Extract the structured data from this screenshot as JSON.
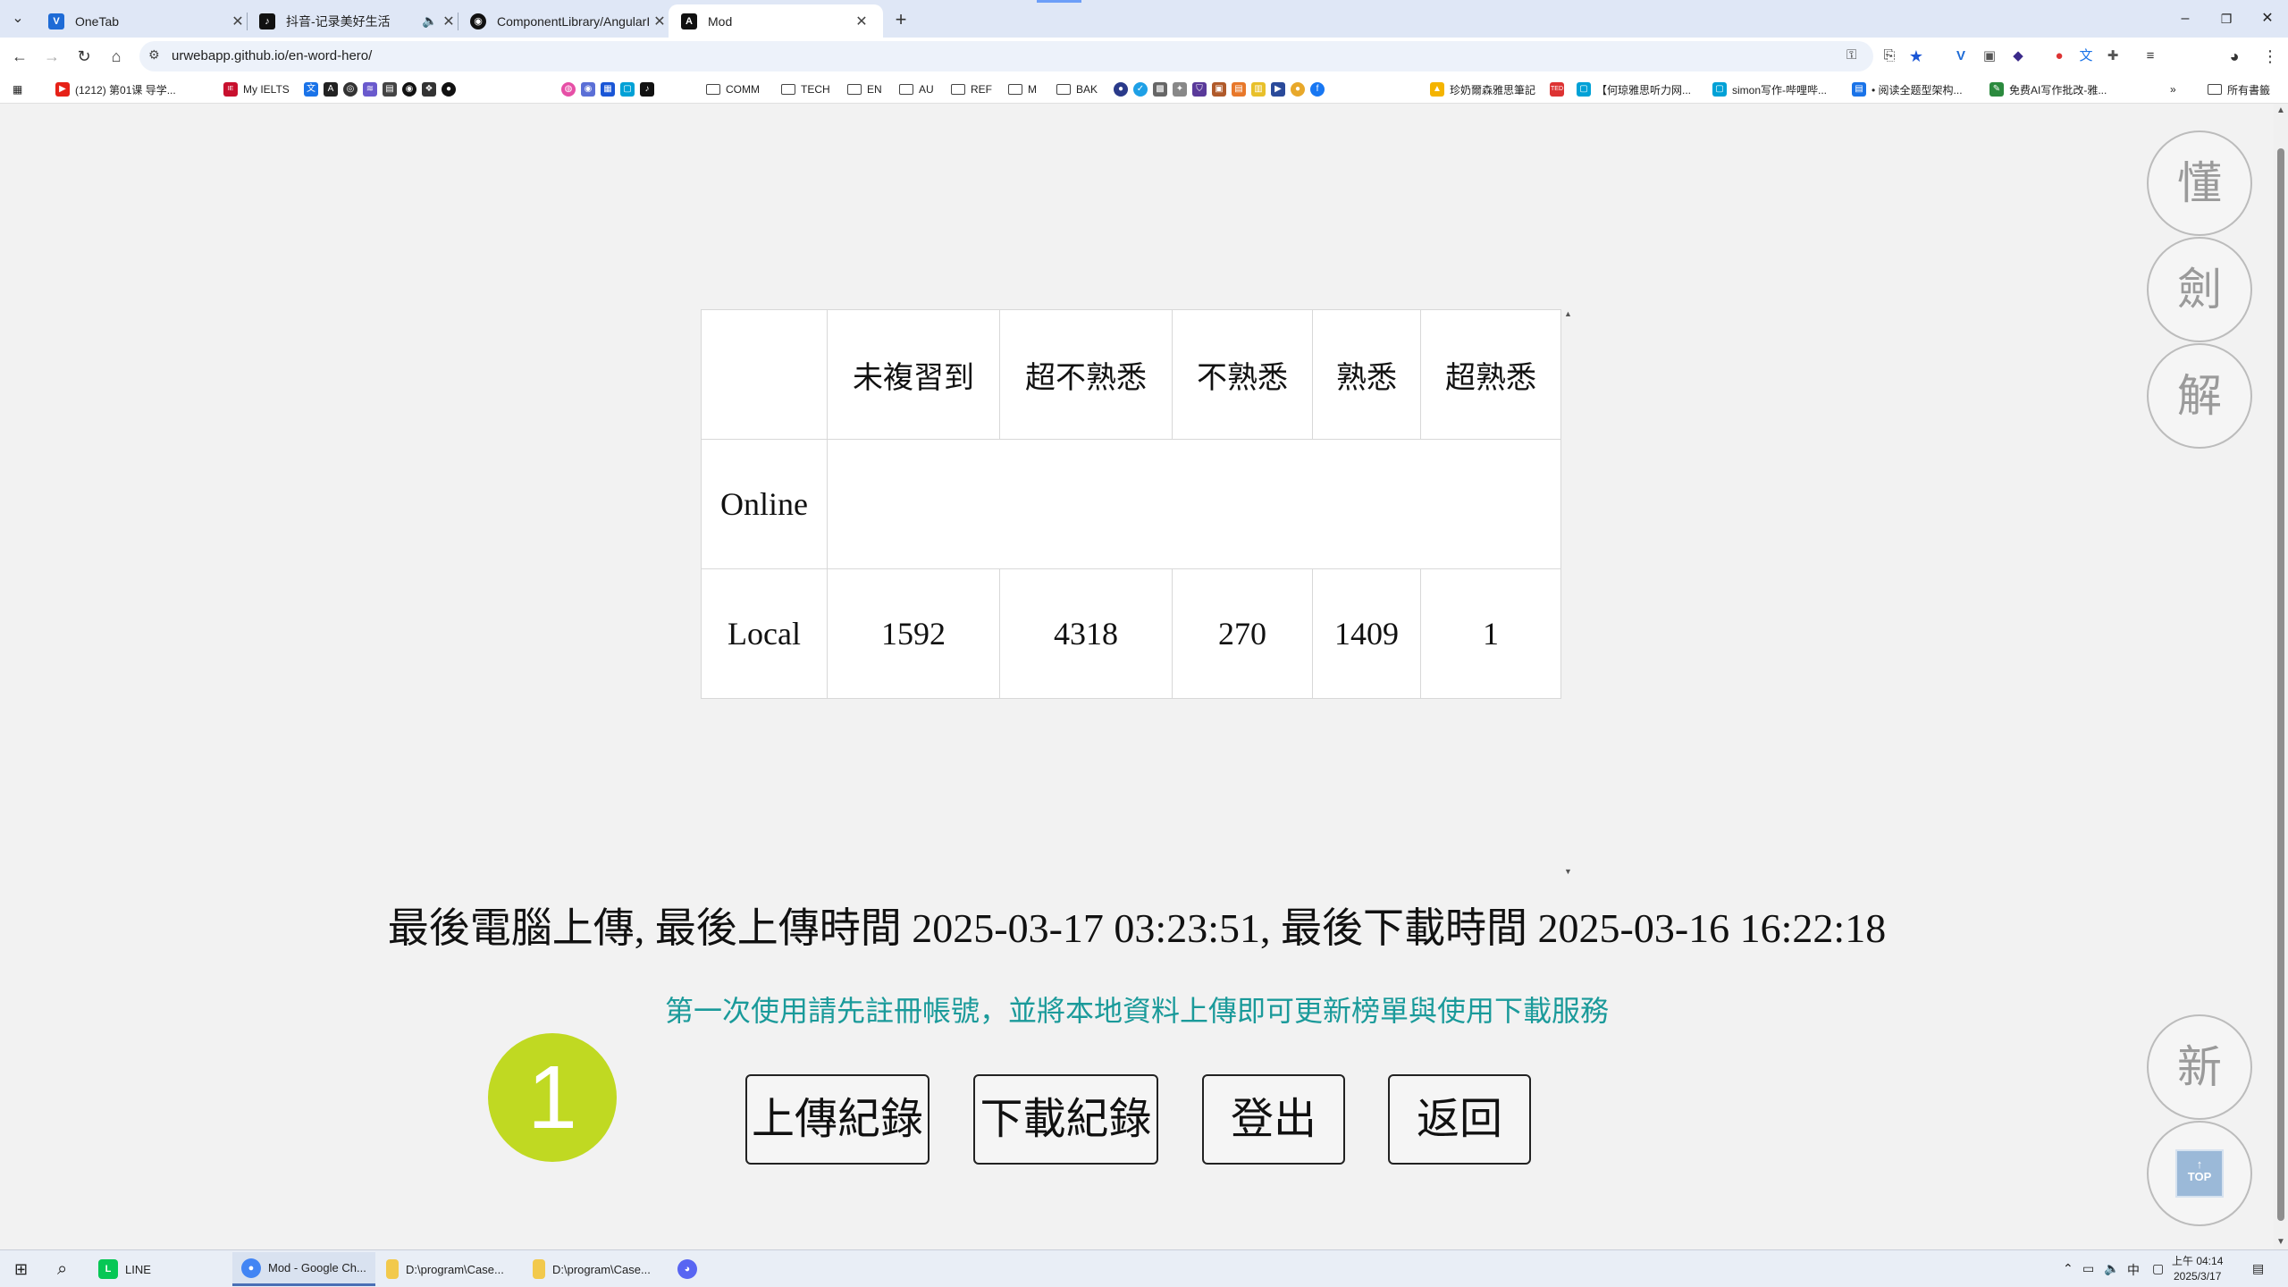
{
  "browser": {
    "tabs": [
      {
        "title": "OneTab",
        "icon": "onetab-icon",
        "color": "#1e6bd6",
        "glyph": "V",
        "active": false
      },
      {
        "title": "抖音-记录美好生活",
        "icon": "douyin-icon",
        "color": "#111111",
        "glyph": "♪",
        "active": false,
        "audio": true
      },
      {
        "title": "ComponentLibrary/AngularI...",
        "icon": "github-icon",
        "color": "#111111",
        "glyph": "◉",
        "active": false
      },
      {
        "title": "Mod",
        "icon": "angular-icon",
        "color": "#111111",
        "glyph": "A",
        "active": true
      }
    ],
    "url": "urwebapp.github.io/en-word-hero/",
    "bookmarks": [
      {
        "label": "",
        "type": "icon",
        "icon": "apps-icon"
      },
      {
        "label": "(1212) 第01课 导学...",
        "type": "icon",
        "icon": "youtube-icon",
        "color": "#e62117"
      },
      {
        "label": "My IELTS",
        "type": "icon",
        "icon": "ielts-icon",
        "color": "#c8102e"
      },
      {
        "label": "COMM",
        "type": "folder"
      },
      {
        "label": "TECH",
        "type": "folder"
      },
      {
        "label": "EN",
        "type": "folder"
      },
      {
        "label": "AU",
        "type": "folder"
      },
      {
        "label": "REF",
        "type": "folder"
      },
      {
        "label": "M",
        "type": "folder"
      },
      {
        "label": "BAK",
        "type": "folder"
      },
      {
        "label": "珍奶爾森雅思筆記",
        "type": "icon",
        "icon": "drive-icon",
        "color": "#f4b400"
      },
      {
        "label": "【何琼雅思听力网...",
        "type": "icon",
        "icon": "bilibili-icon",
        "color": "#00a1d6"
      },
      {
        "label": "simon写作-哔哩哔...",
        "type": "icon",
        "icon": "bilibili-icon",
        "color": "#00a1d6"
      },
      {
        "label": "• 阅读全题型架构...",
        "type": "icon",
        "icon": "docs-icon",
        "color": "#1a73e8"
      },
      {
        "label": "免费AI写作批改-雅...",
        "type": "icon",
        "icon": "pen-icon",
        "color": "#2b8a3e"
      },
      {
        "label": "所有書籤",
        "type": "folder"
      }
    ]
  },
  "side_buttons": [
    {
      "label": "懂",
      "name": "understand-button"
    },
    {
      "label": "劍",
      "name": "sword-button"
    },
    {
      "label": "解",
      "name": "explain-button"
    },
    {
      "label": "新",
      "name": "new-button"
    },
    {
      "label": "TOP",
      "name": "top-button"
    }
  ],
  "stats": {
    "headers": [
      "",
      "未複習到",
      "超不熟悉",
      "不熟悉",
      "熟悉",
      "超熟悉"
    ],
    "rows": [
      {
        "label": "Online",
        "values": [
          "",
          "",
          "",
          "",
          ""
        ]
      },
      {
        "label": "Local",
        "values": [
          "1592",
          "4318",
          "270",
          "1409",
          "1"
        ]
      }
    ]
  },
  "status_line": "最後電腦上傳, 最後上傳時間 2025-03-17 03:23:51, 最後下載時間 2025-03-16 16:22:18",
  "hint": "第一次使用請先註冊帳號，並將本地資料上傳即可更新榜單與使用下載服務",
  "badge": "1",
  "actions": {
    "upload": "上傳紀錄",
    "download": "下載紀錄",
    "logout": "登出",
    "back": "返回"
  },
  "taskbar": {
    "items": [
      {
        "label": "LINE",
        "icon": "line-icon",
        "color": "#06c755"
      },
      {
        "label": "Mod - Google Ch...",
        "icon": "chrome-icon",
        "color": "#4285f4"
      },
      {
        "label": "D:\\program\\Case...",
        "icon": "folder-icon",
        "color": "#f2c94c"
      },
      {
        "label": "D:\\program\\Case...",
        "icon": "folder-icon",
        "color": "#f2c94c"
      }
    ],
    "ime": "中",
    "time": "上午 04:14",
    "date": "2025/3/17"
  },
  "colors": {
    "badge": "#c0d922",
    "hint": "#1a9a9a",
    "tabstrip": "#dfe7f6"
  }
}
